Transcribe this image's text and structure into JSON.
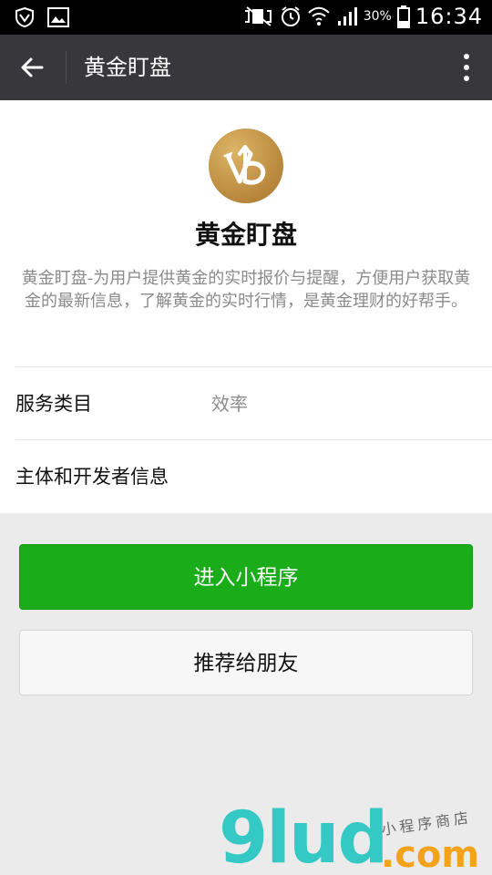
{
  "status_bar": {
    "battery": "30%",
    "time": "16:34",
    "icons": [
      "shield-icon",
      "image-icon",
      "nfc-vibrate-icon",
      "alarm-icon",
      "wifi-icon",
      "signal-icon",
      "battery-icon"
    ]
  },
  "app_bar": {
    "title": "黄金盯盘",
    "back_icon": "arrow-back-icon",
    "menu_icon": "more-vert-icon"
  },
  "mini_program": {
    "name": "黄金盯盘",
    "description": "黄金盯盘-为用户提供黄金的实时报价与提醒，方便用户获取黄金的最新信息，了解黄金的实时行情，是黄金理财的好帮手。",
    "logo_icon": "gold-logo-icon"
  },
  "info_rows": [
    {
      "label": "服务类目",
      "value": "效率"
    },
    {
      "label": "主体和开发者信息"
    }
  ],
  "actions": {
    "enter_label": "进入小程序",
    "share_label": "推荐给朋友"
  },
  "watermark": {
    "brand": "9lud",
    "domain": ".com",
    "tagline": "小程序商店"
  },
  "colors": {
    "app_bar": "#38373c",
    "primary": "#1aad19",
    "logo_gold": "#c59a48"
  }
}
